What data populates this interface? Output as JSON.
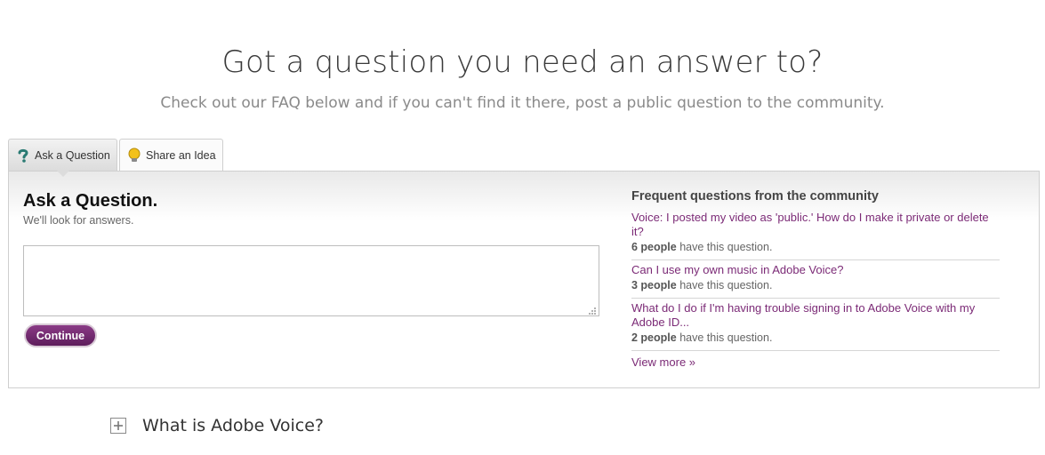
{
  "hero": {
    "title": "Got a question you need an answer to?",
    "subtitle": "Check out our FAQ below and if you can't find it there, post a public question to the community."
  },
  "tabs": [
    {
      "label": "Ask a Question",
      "icon": "question-mark-icon",
      "active": true
    },
    {
      "label": "Share an Idea",
      "icon": "lightbulb-icon",
      "active": false
    }
  ],
  "ask": {
    "title": "Ask a Question.",
    "subtitle": "We'll look for answers.",
    "input_value": "",
    "continue_label": "Continue"
  },
  "faq": {
    "heading": "Frequent questions from the community",
    "items": [
      {
        "question": "Voice: I posted my video as 'public.' How do I make it private or delete it?",
        "count": "6 people",
        "suffix": "have this question."
      },
      {
        "question": "Can I use my own music in Adobe Voice?",
        "count": "3 people",
        "suffix": "have this question."
      },
      {
        "question": "What do I do if I'm having trouble signing in to Adobe Voice with my Adobe ID...",
        "count": "2 people",
        "suffix": "have this question."
      }
    ],
    "view_more": "View more »"
  },
  "accordion": {
    "items": [
      {
        "label": "What is Adobe Voice?"
      }
    ]
  },
  "colors": {
    "brand_purple": "#7b2a76",
    "button_purple": "#6a2467"
  }
}
